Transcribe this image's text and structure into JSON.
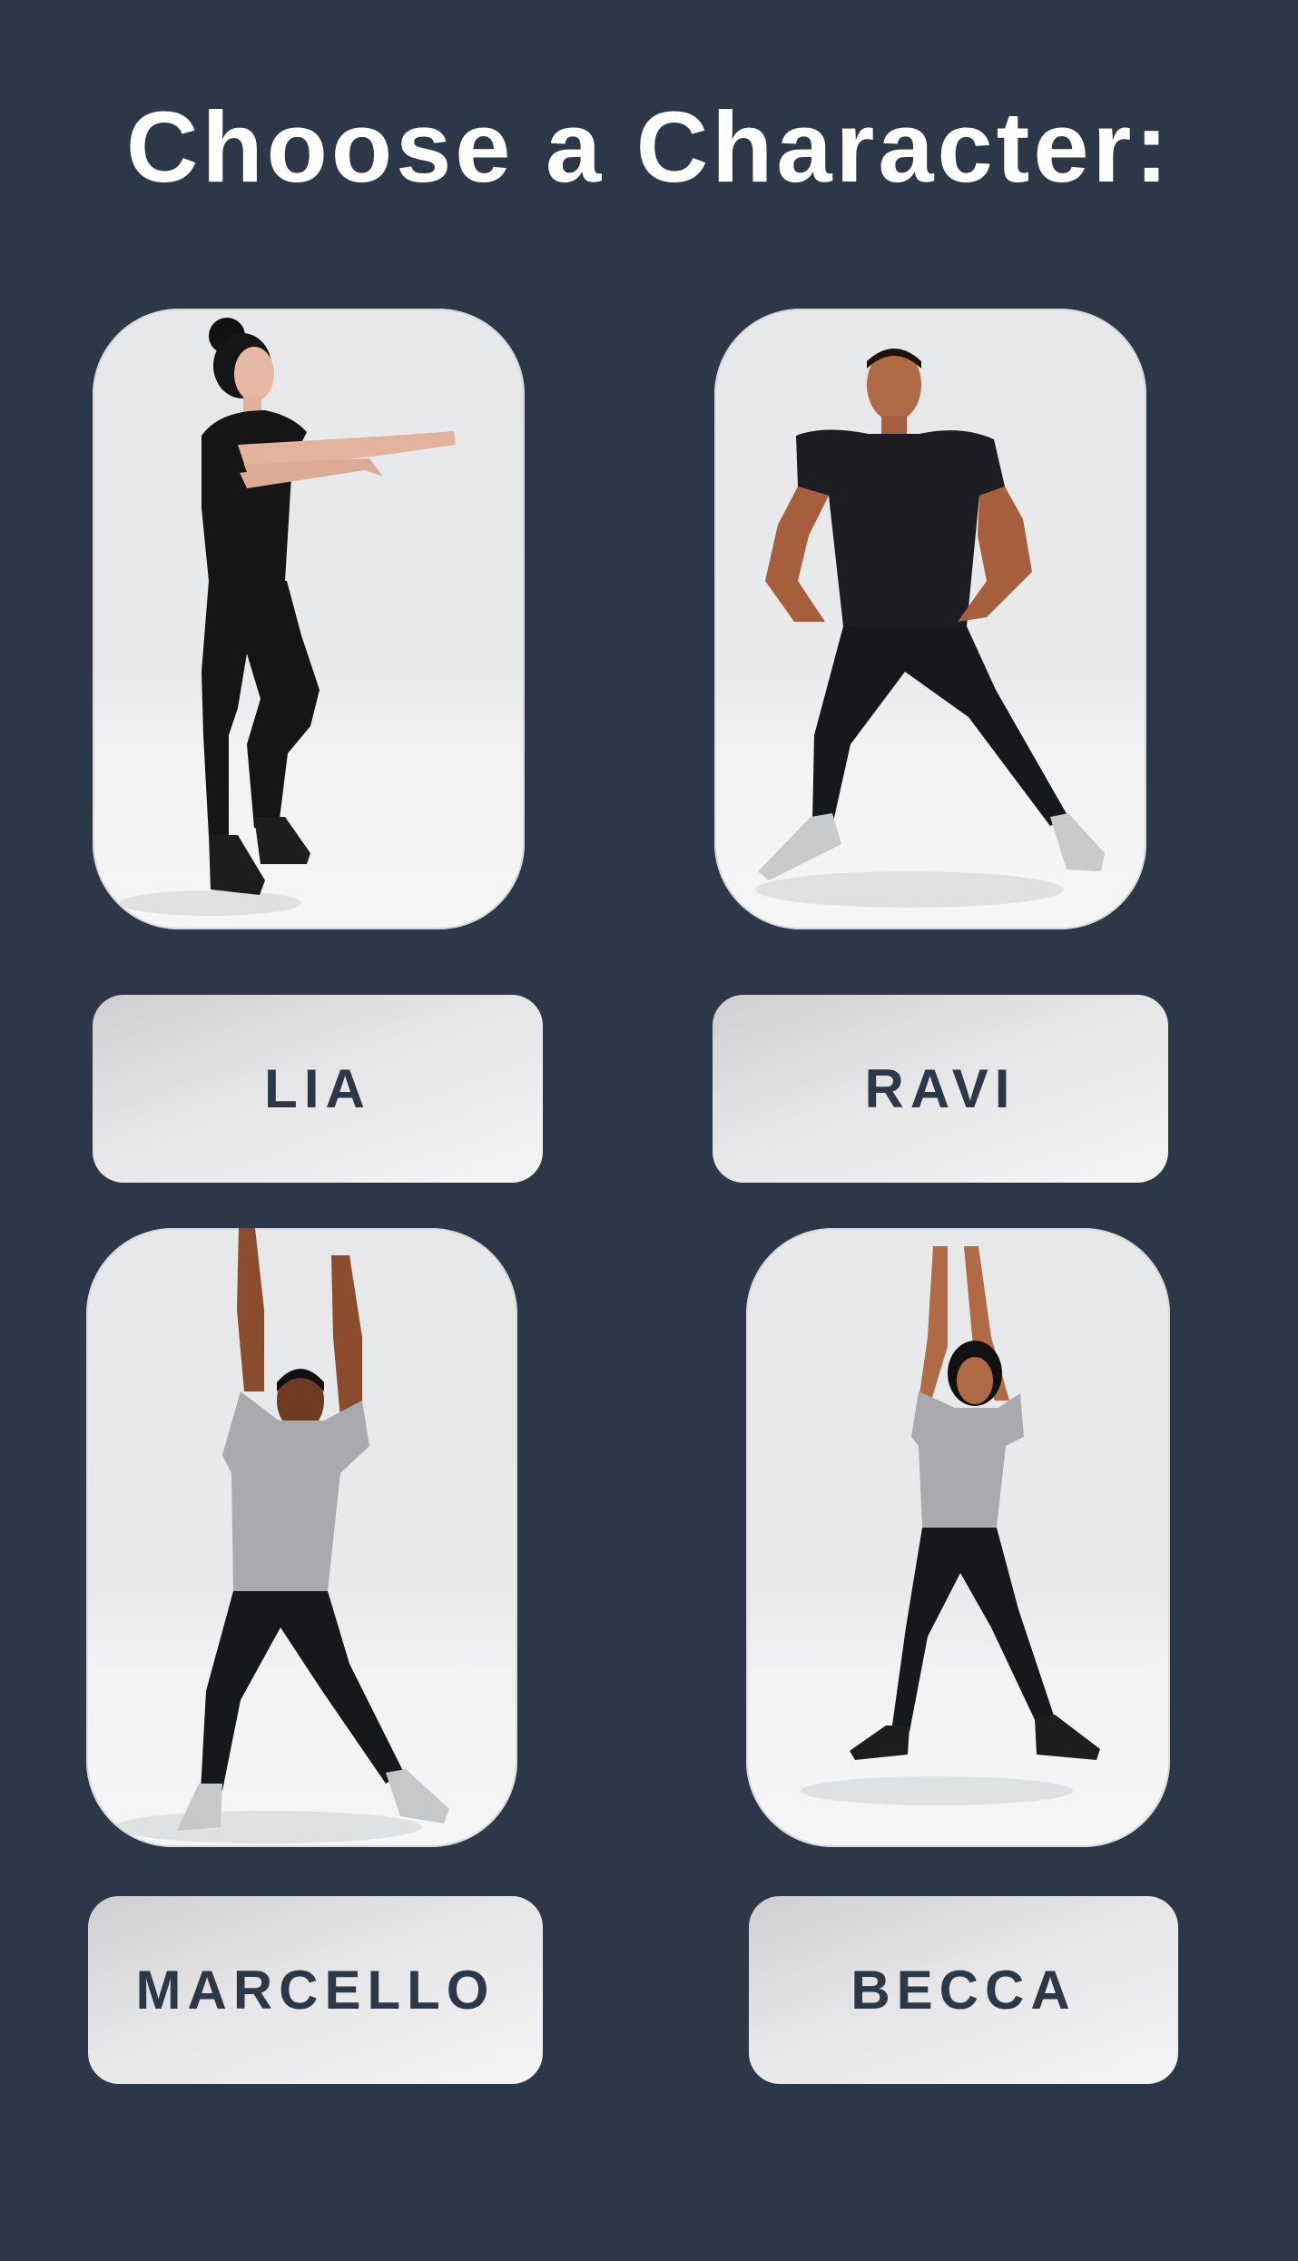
{
  "header": {
    "title": "Choose a Character:"
  },
  "characters": [
    {
      "name": "LIA"
    },
    {
      "name": "RAVI"
    },
    {
      "name": "MARCELLO"
    },
    {
      "name": "BECCA"
    }
  ],
  "colors": {
    "background": "#2c3748",
    "card": "#e8e9eb",
    "button_text": "#2c3748",
    "title_text": "#ffffff"
  }
}
